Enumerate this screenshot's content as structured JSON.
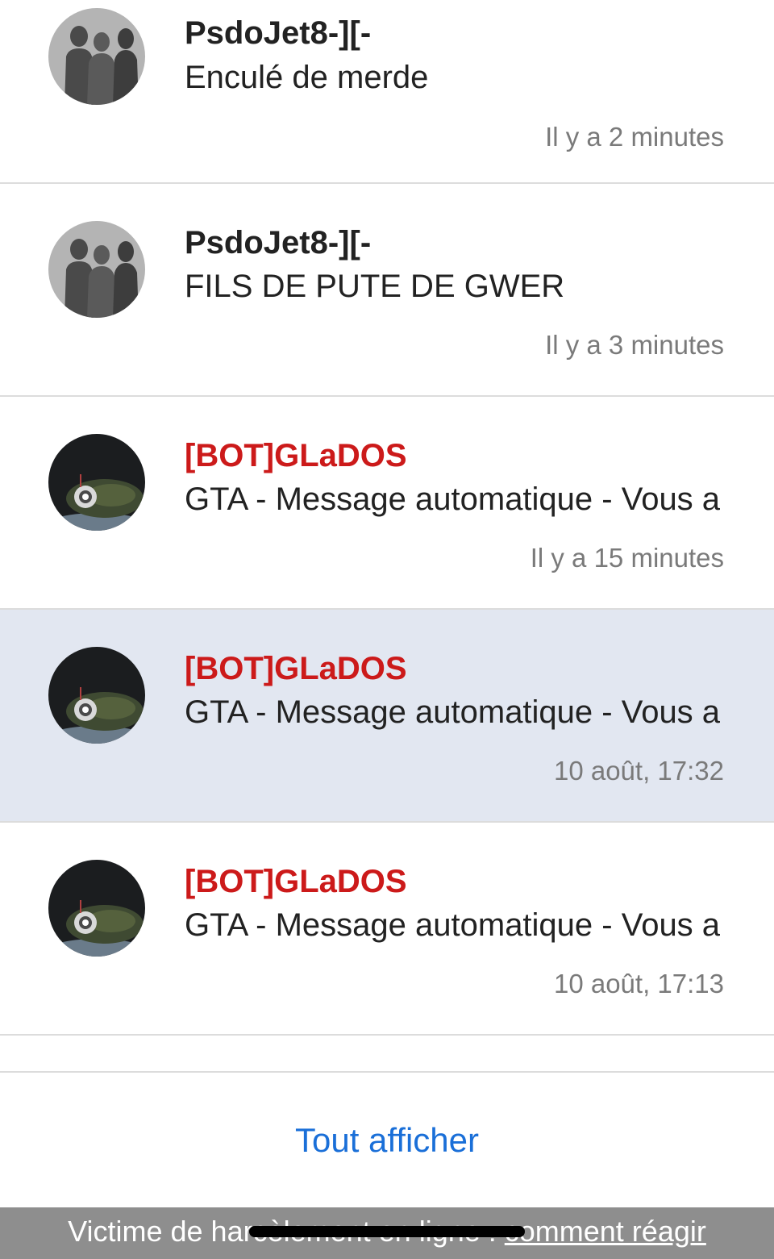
{
  "notifications": [
    {
      "author": "PsdoJet8-][-",
      "author_type": "user",
      "avatar": "silhouettes-avatar",
      "message": "Enculé de merde",
      "time": "Il y a 2 minutes",
      "highlighted": false
    },
    {
      "author": "PsdoJet8-][-",
      "author_type": "user",
      "avatar": "silhouettes-avatar",
      "message": "FILS DE PUTE DE GWER",
      "time": "Il y a 3 minutes",
      "highlighted": false
    },
    {
      "author": "[BOT]GLaDOS",
      "author_type": "bot",
      "avatar": "robot-avatar",
      "message": "GTA - Message automatique - Vous a",
      "time": "Il y a 15 minutes",
      "highlighted": false
    },
    {
      "author": "[BOT]GLaDOS",
      "author_type": "bot",
      "avatar": "robot-avatar",
      "message": "GTA - Message automatique - Vous a",
      "time": "10 août, 17:32",
      "highlighted": true
    },
    {
      "author": "[BOT]GLaDOS",
      "author_type": "bot",
      "avatar": "robot-avatar",
      "message": "GTA - Message automatique - Vous a",
      "time": "10 août, 17:13",
      "highlighted": false
    }
  ],
  "show_all_label": "Tout afficher",
  "footer": {
    "text": "Victime de harcèlement en ligne : ",
    "link_label": "comment réagir"
  },
  "colors": {
    "bot_name": "#cc1a1a",
    "link": "#1a6fd8",
    "highlight_row": "#e2e7f1",
    "footer_bg": "#8e8e8e"
  }
}
